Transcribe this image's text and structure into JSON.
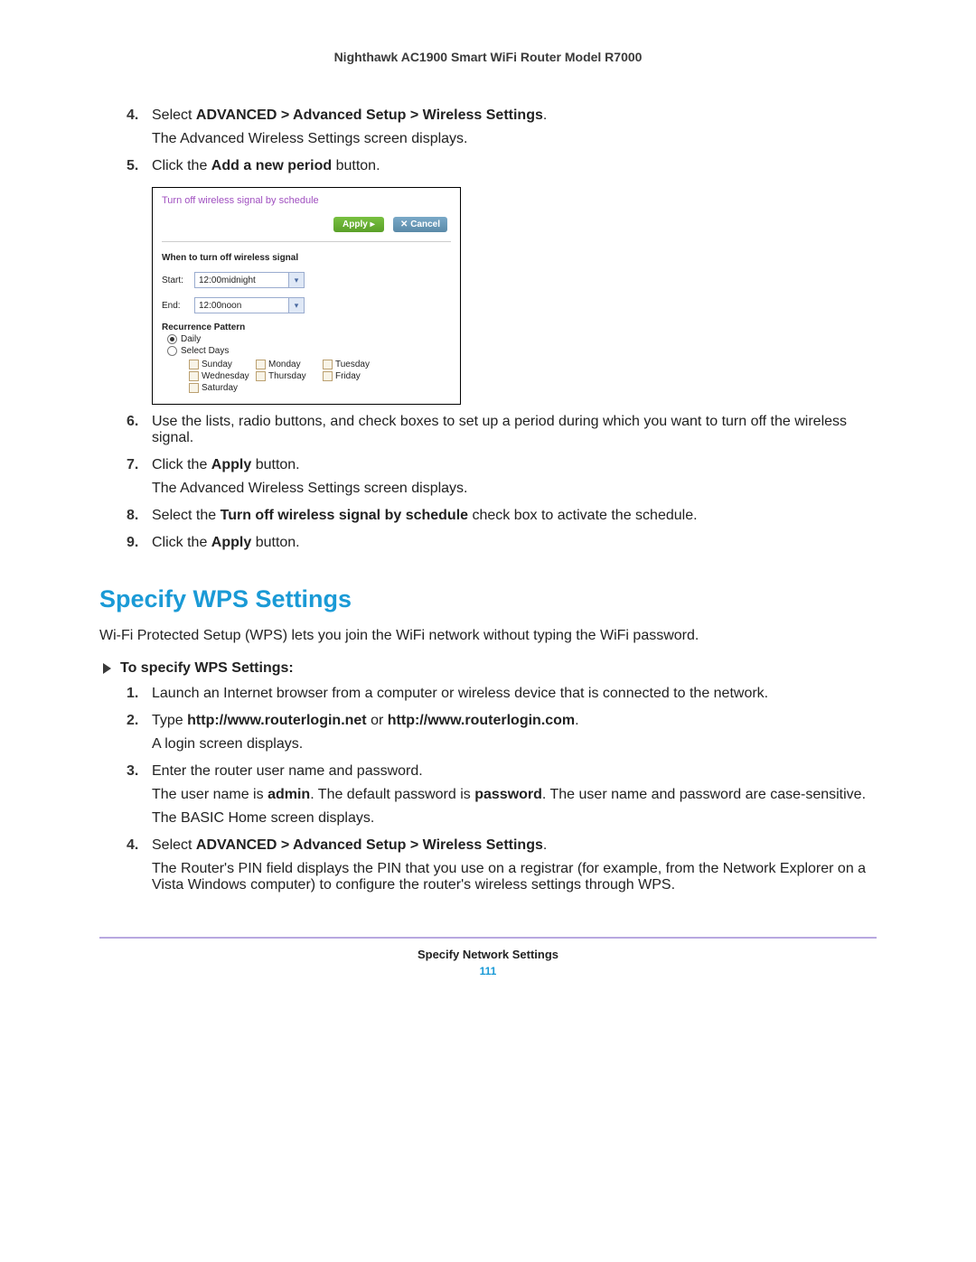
{
  "header": {
    "title": "Nighthawk AC1900 Smart WiFi Router Model R7000"
  },
  "stepsA": [
    {
      "num": "4.",
      "prefix": "Select ",
      "bold": "ADVANCED > Advanced Setup > Wireless Settings",
      "suffix": ".",
      "after": "The Advanced Wireless Settings screen displays."
    },
    {
      "num": "5.",
      "prefix": "Click the ",
      "bold": "Add a new period",
      "suffix": " button."
    }
  ],
  "screenshot": {
    "title": "Turn off wireless signal by schedule",
    "apply": "Apply ▸",
    "cancel": "✕ Cancel",
    "when_label": "When to turn off wireless signal",
    "start_label": "Start:",
    "start_value": "12:00midnight",
    "end_label": "End:",
    "end_value": "12:00noon",
    "recur_label": "Recurrence Pattern",
    "daily": "Daily",
    "selectdays": "Select Days",
    "days": [
      "Sunday",
      "Monday",
      "Tuesday",
      "Wednesday",
      "Thursday",
      "Friday",
      "Saturday"
    ]
  },
  "stepsB": [
    {
      "num": "6.",
      "text": "Use the lists, radio buttons, and check boxes to set up a period during which you want to turn off the wireless signal."
    },
    {
      "num": "7.",
      "prefix": "Click the ",
      "bold": "Apply",
      "suffix": " button.",
      "after": "The Advanced Wireless Settings screen displays."
    },
    {
      "num": "8.",
      "prefix": "Select the ",
      "bold": "Turn off wireless signal by schedule",
      "suffix": " check box to activate the schedule."
    },
    {
      "num": "9.",
      "prefix": "Click the ",
      "bold": "Apply",
      "suffix": " button."
    }
  ],
  "section": {
    "heading": "Specify WPS Settings",
    "intro": "Wi-Fi Protected Setup (WPS) lets you join the WiFi network without typing the WiFi password.",
    "procedure_head": "To specify WPS Settings:"
  },
  "stepsC": [
    {
      "num": "1.",
      "text": "Launch an Internet browser from a computer or wireless device that is connected to the network."
    },
    {
      "num": "2.",
      "prefix": "Type ",
      "bold": "http://www.routerlogin.net",
      "mid": " or ",
      "bold2": "http://www.routerlogin.com",
      "suffix": ".",
      "after": "A login screen displays."
    },
    {
      "num": "3.",
      "text": "Enter the router user name and password.",
      "after_rich": {
        "p1_pre": "The user name is ",
        "p1_b1": "admin",
        "p1_mid": ". The default password is ",
        "p1_b2": "password",
        "p1_post": ". The user name and password are case-sensitive."
      },
      "after2": "The BASIC Home screen displays."
    },
    {
      "num": "4.",
      "prefix": "Select ",
      "bold": "ADVANCED > Advanced Setup > Wireless Settings",
      "suffix": ".",
      "after": "The Router's PIN field displays the PIN that you use on a registrar (for example, from the Network Explorer on a Vista Windows computer) to configure the router's wireless settings through WPS."
    }
  ],
  "footer": {
    "section": "Specify Network Settings",
    "page": "111"
  }
}
